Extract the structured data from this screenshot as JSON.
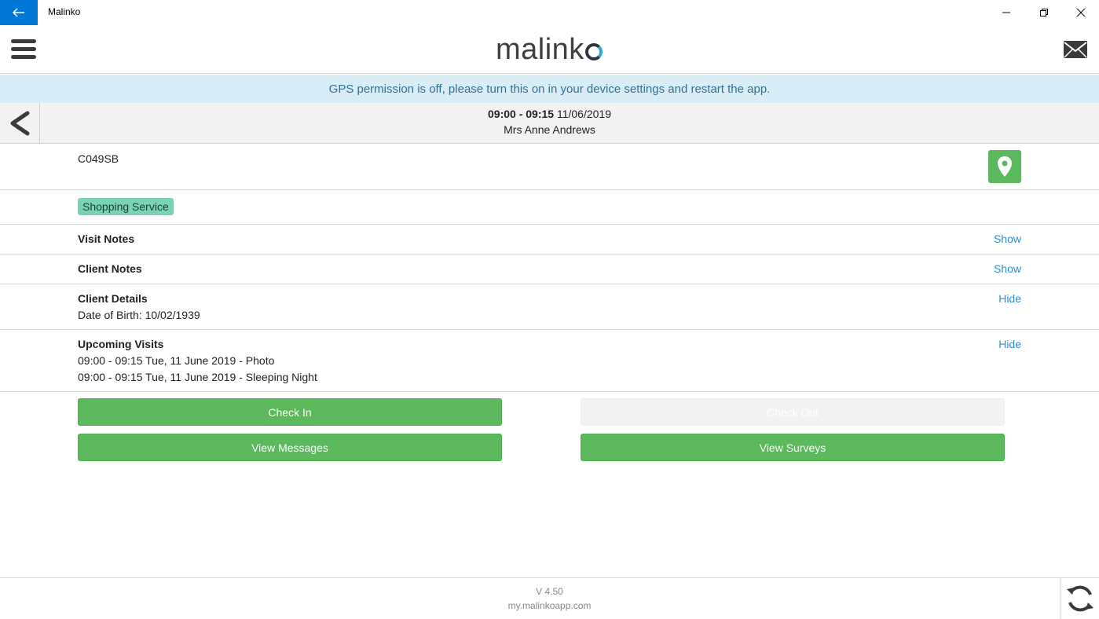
{
  "window": {
    "title": "Malinko"
  },
  "header": {
    "logo_text": "malink"
  },
  "banner": {
    "text": "GPS permission is off, please turn this on in your device settings and restart the app."
  },
  "visit": {
    "time": "09:00 - 09:15",
    "date": "11/06/2019",
    "client": "Mrs Anne Andrews"
  },
  "postcode": "C049SB",
  "service_tag": "Shopping Service",
  "sections": {
    "visit_notes": {
      "label": "Visit Notes",
      "action": "Show"
    },
    "client_notes": {
      "label": "Client Notes",
      "action": "Show"
    },
    "client_details": {
      "label": "Client Details",
      "action": "Hide",
      "dob": "Date of Birth: 10/02/1939"
    },
    "upcoming_visits": {
      "label": "Upcoming Visits",
      "action": "Hide",
      "items": [
        "09:00 - 09:15 Tue, 11 June 2019 - Photo",
        "09:00 - 09:15 Tue, 11 June 2019 - Sleeping Night"
      ]
    }
  },
  "buttons": {
    "check_in": "Check In",
    "check_out": "Check Out",
    "view_messages": "View Messages",
    "view_surveys": "View Surveys"
  },
  "footer": {
    "version": "V 4.50",
    "site": "my.malinkoapp.com"
  },
  "colors": {
    "accent": "#0078d7",
    "green": "#5cb85c",
    "link": "#2a8fd0",
    "banner_bg": "#d9edf7",
    "banner_text": "#31708f",
    "tag_bg": "#7ad3b7"
  }
}
